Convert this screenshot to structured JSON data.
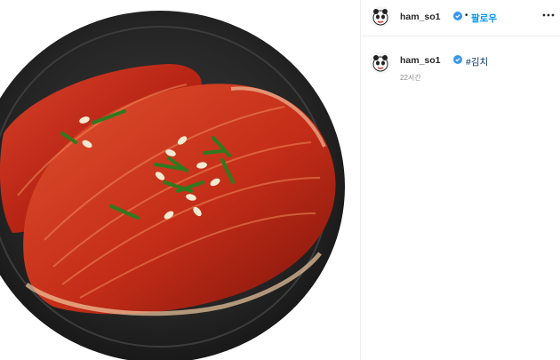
{
  "post": {
    "author": "ham_so1",
    "follow_label": "팔로우",
    "separator": "•",
    "caption_hashtag": "#김치",
    "time_ago": "22시간",
    "image_subject": "kimchi-on-black-plate"
  },
  "icons": {
    "verified": "verified-badge-icon",
    "more": "more-options-icon"
  },
  "colors": {
    "follow_blue": "#0095f6",
    "hashtag": "#00376b",
    "verified_blue": "#3897f0",
    "kimchi_red": "#c0281a"
  }
}
